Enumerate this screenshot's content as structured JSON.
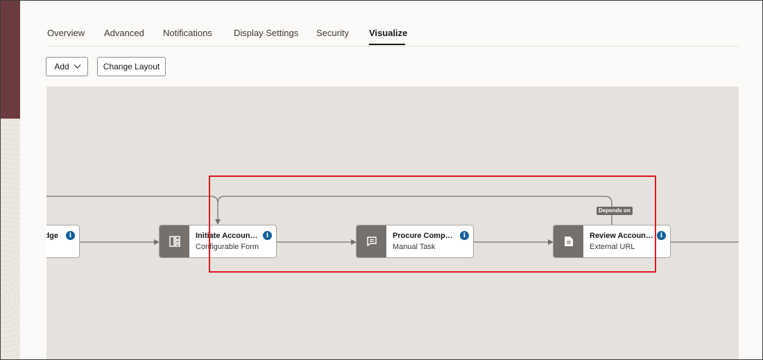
{
  "tabs": [
    {
      "label": "Overview"
    },
    {
      "label": "Advanced"
    },
    {
      "label": "Notifications"
    },
    {
      "label": "Display Settings"
    },
    {
      "label": "Security"
    },
    {
      "label": "Visualize",
      "active": true
    }
  ],
  "toolbar": {
    "add_label": "Add",
    "change_layout_label": "Change Layout"
  },
  "canvas": {
    "nodes": [
      {
        "title": "Ackn...edge",
        "visible_title": "dge",
        "subtitle": ""
      },
      {
        "title": "Initiate Account…",
        "subtitle": "Configurable Form",
        "icon": "form-icon"
      },
      {
        "title": "Procure Compute…",
        "subtitle": "Manual Task",
        "icon": "chat-icon"
      },
      {
        "title": "Review Account…",
        "subtitle": "External URL",
        "icon": "document-icon"
      }
    ],
    "dependency_label": "Depends on",
    "info_symbol": "i"
  },
  "colors": {
    "brand": "#6b3b40",
    "canvas_bg": "#e5e2dd",
    "node_icon_bg": "#75706b",
    "info": "#14609a",
    "highlight": "#e0151b"
  }
}
